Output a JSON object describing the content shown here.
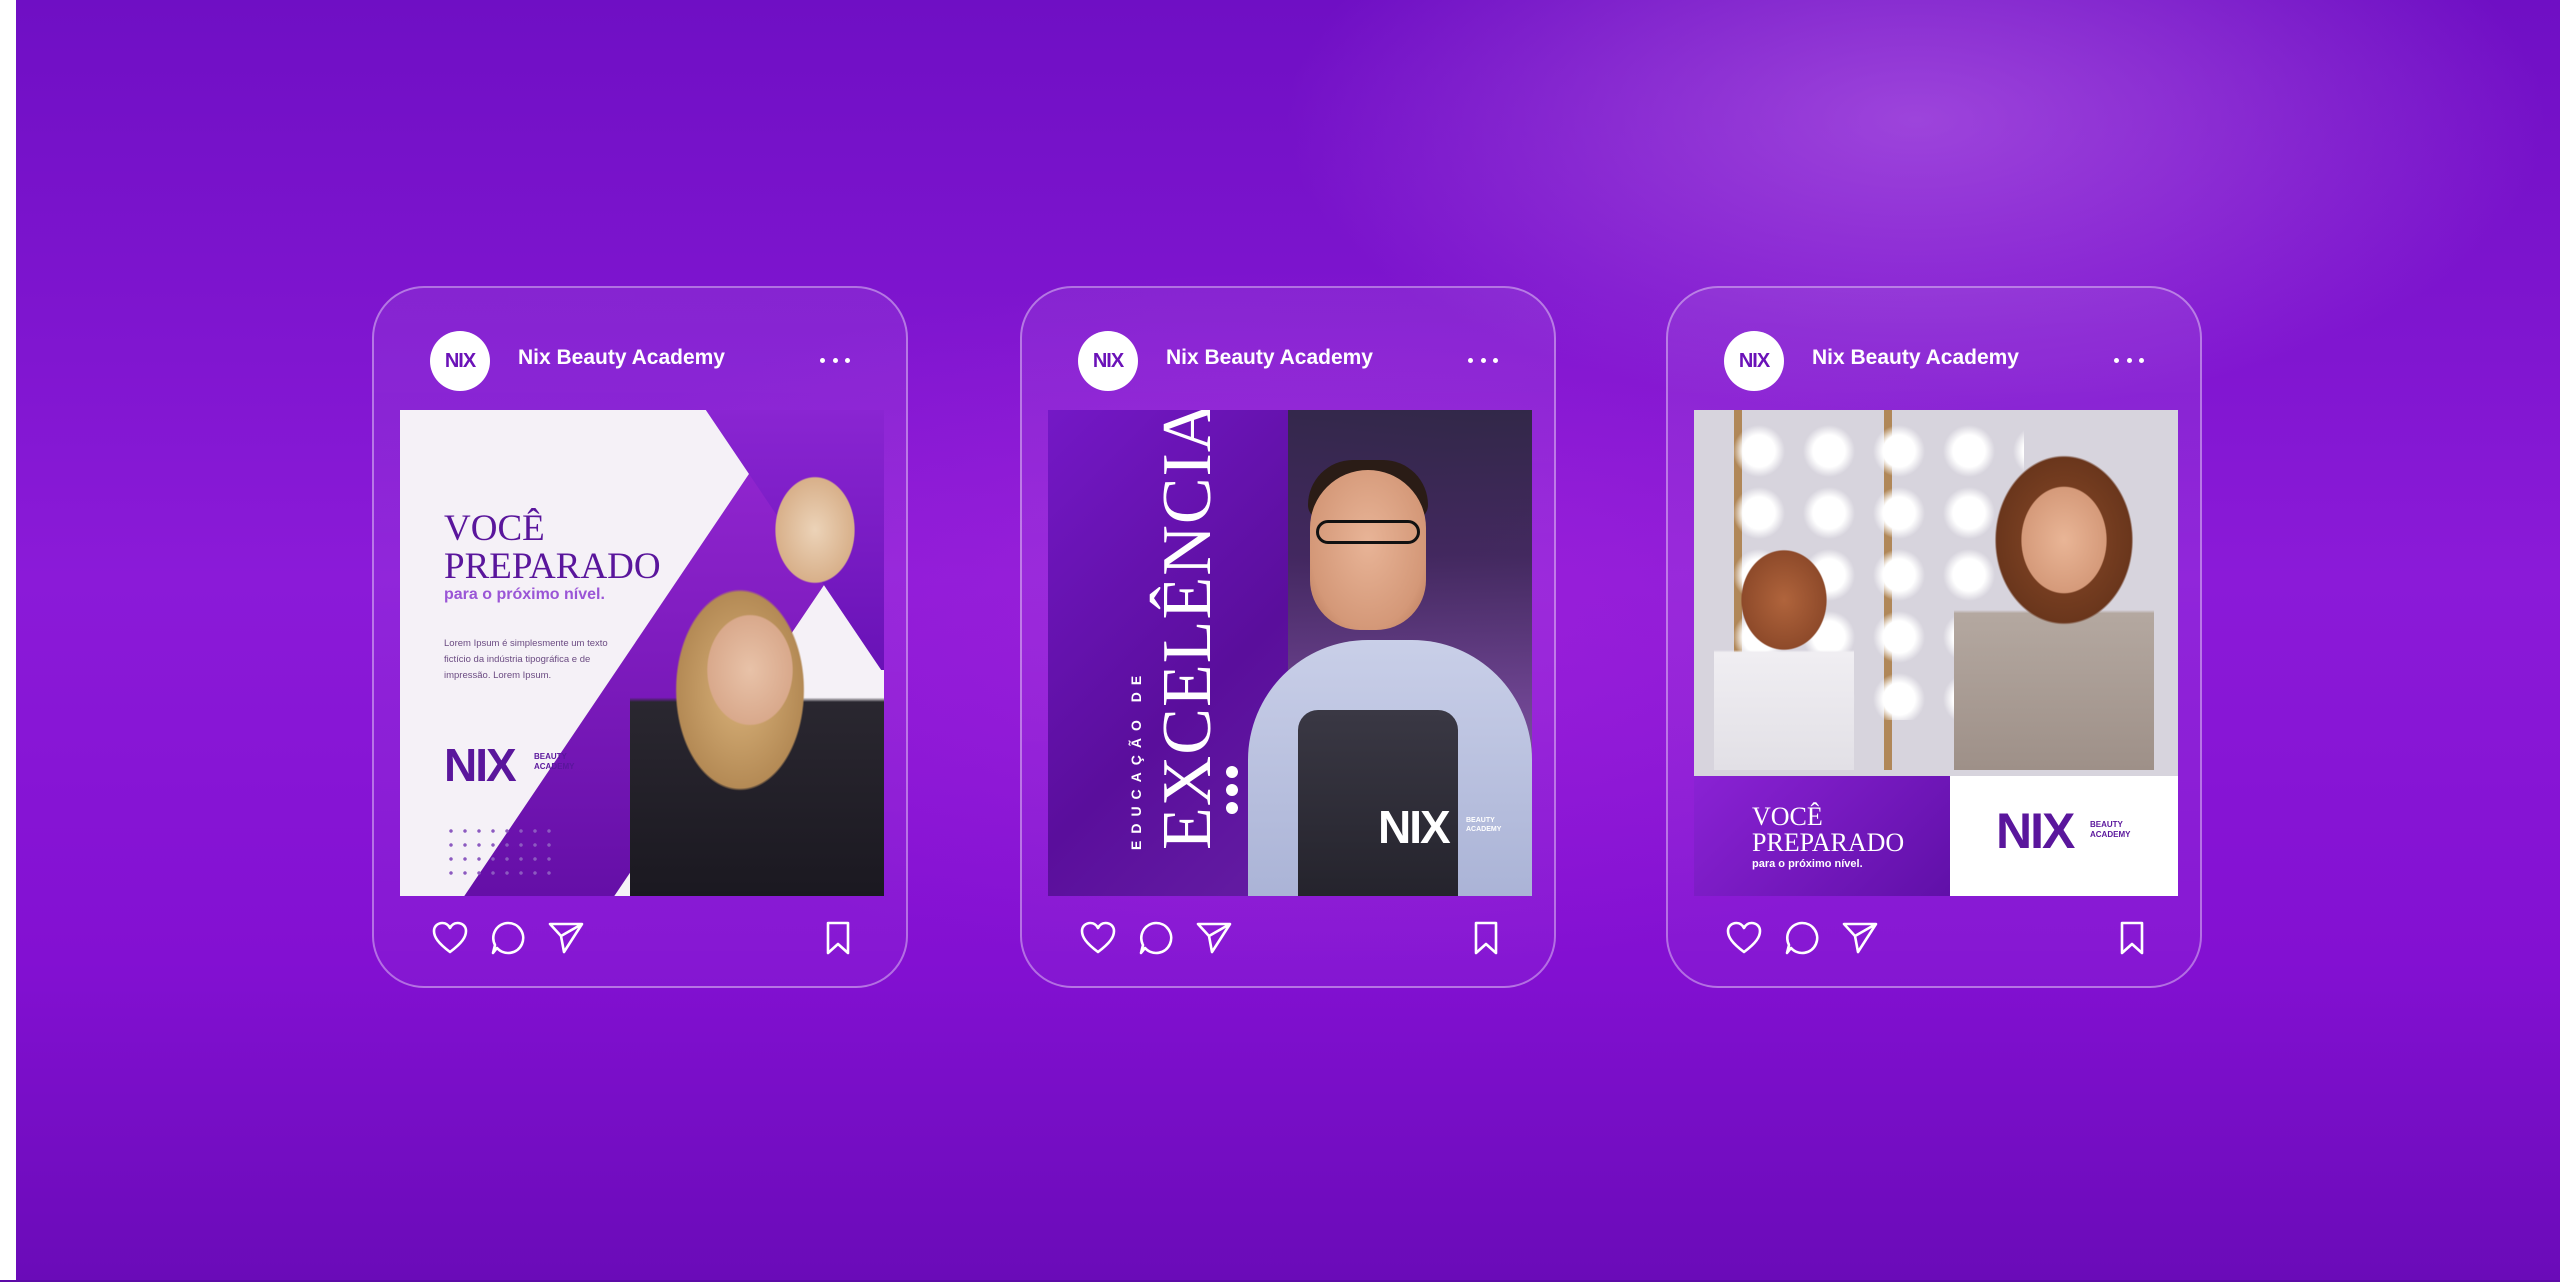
{
  "brand_colors": {
    "purple": "#7a12c4",
    "deep_purple": "#5a169c",
    "white": "#ffffff"
  },
  "posts": [
    {
      "account_name": "Nix Beauty Academy",
      "avatar_text": "NIX",
      "image": {
        "title_line1": "VOCÊ",
        "title_line2": "PREPARADO",
        "subtitle": "para o próximo nível.",
        "body": "Lorem Ipsum é simplesmente um texto fictício da indústria tipográfica e de impressão. Lorem Ipsum.",
        "logo": "NIX",
        "logo_sub1": "BEAUTY",
        "logo_sub2": "ACADEMY"
      }
    },
    {
      "account_name": "Nix Beauty Academy",
      "avatar_text": "NIX",
      "image": {
        "vertical_small": "EDUCAÇÃO DE",
        "vertical_big": "EXCELÊNCIA",
        "logo": "NIX",
        "logo_sub1": "BEAUTY",
        "logo_sub2": "ACADEMY"
      }
    },
    {
      "account_name": "Nix Beauty Academy",
      "avatar_text": "NIX",
      "image": {
        "title_line1": "VOCÊ",
        "title_line2": "PREPARADO",
        "subtitle": "para o próximo nível.",
        "logo": "NIX",
        "logo_sub1": "BEAUTY",
        "logo_sub2": "ACADEMY"
      }
    }
  ],
  "icons": [
    "heart-icon",
    "comment-icon",
    "send-icon",
    "bookmark-icon",
    "more-icon"
  ]
}
